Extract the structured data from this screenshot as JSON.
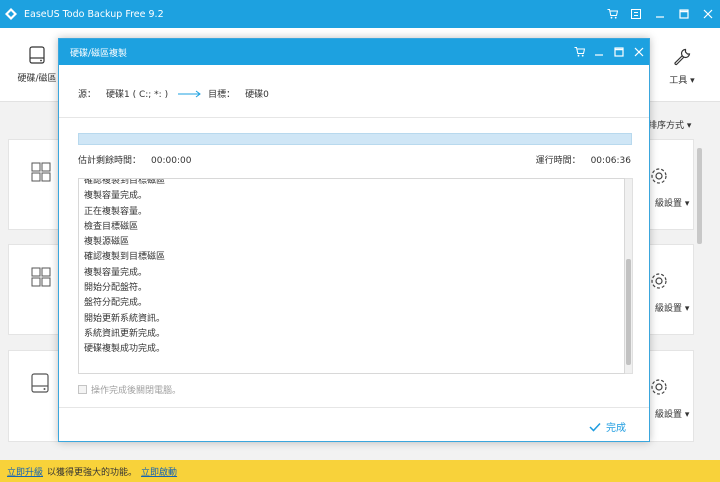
{
  "app": {
    "title": "EaseUS Todo Backup Free 9.2",
    "toolbar_disk_label": "硬碟/磁區",
    "toolbar_tools_label": "工具",
    "sort_label": "排序方式",
    "advanced_label": "級設置"
  },
  "promo": {
    "upgrade_link": "立即升級",
    "middle_text": "以獲得更強大的功能。",
    "activate_link": "立即啟動"
  },
  "dialog": {
    "title": "硬碟/磁區複製",
    "source_label": "源：",
    "source_value": "硬碟1 ( C:; *: )",
    "target_label": "目標：",
    "target_value": "硬碟0",
    "progress_fraction": 1.0,
    "est_label": "估計剩餘時間：",
    "est_value": "00:00:00",
    "elapsed_label": "運行時間：",
    "elapsed_value": "00:06:36",
    "log": [
      "確認複製到目標磁區",
      "複製容量完成。",
      "正在複製容量。",
      "檢查目標磁區",
      "複製源磁區",
      "確認複製到目標磁區",
      "複製容量完成。",
      "開始分配盤符。",
      "盤符分配完成。",
      "開始更新系統資訊。",
      "系統資訊更新完成。",
      "硬碟複製成功完成。"
    ],
    "shutdown_checkbox_label": "操作完成後關閉電腦。",
    "shutdown_checked": false,
    "done_label": "完成"
  },
  "colors": {
    "accent": "#1da1e0",
    "promo_bg": "#f8d23a",
    "link": "#1464b4"
  }
}
